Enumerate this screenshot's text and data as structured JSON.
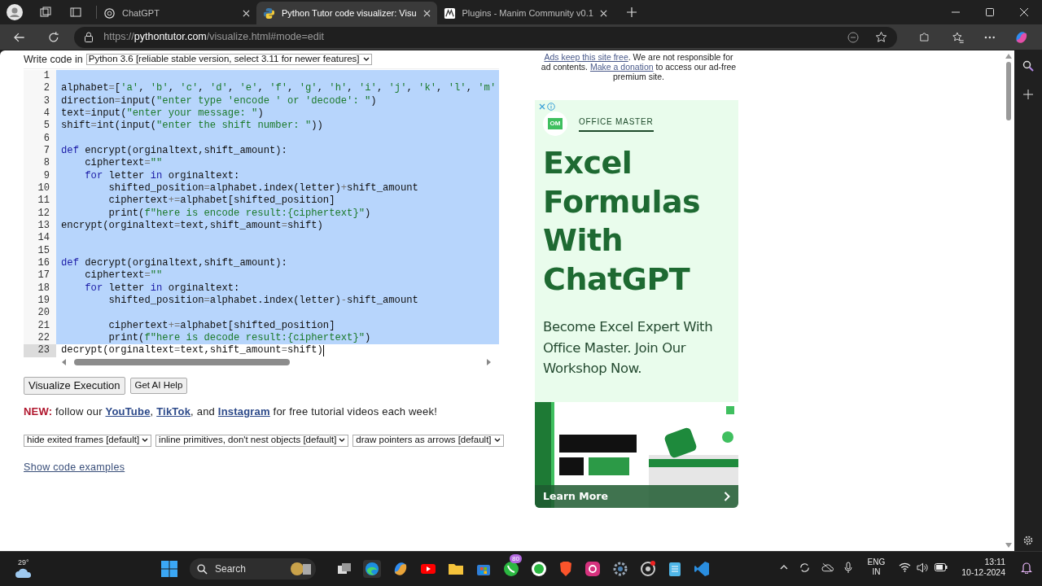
{
  "browser": {
    "tabs": [
      {
        "kind": "chat",
        "title": "ChatGPT",
        "selected": false
      },
      {
        "kind": "python",
        "title": "Python Tutor code visualizer: Visu",
        "selected": true
      },
      {
        "kind": "manim",
        "title": "Plugins - Manim Community v0.1",
        "selected": false
      }
    ],
    "address": {
      "scheme": "https://",
      "host": "pythontutor.com",
      "path": "/visualize.html#mode=edit"
    }
  },
  "editor": {
    "language_label": "Write code in",
    "language": "Python 3.6 [reliable stable version, select 3.11 for newer features]",
    "lines": [
      {
        "number": "1",
        "selected": true,
        "active": false
      },
      {
        "number": "2",
        "selected": true,
        "active": false,
        "tokens": [
          {
            "kind": "plain",
            "text": "alphabet"
          },
          {
            "kind": "operator",
            "text": "="
          },
          {
            "kind": "plain",
            "text": "["
          },
          {
            "kind": "string",
            "text": "'a'"
          },
          {
            "kind": "plain",
            "text": ", "
          },
          {
            "kind": "string",
            "text": "'b'"
          },
          {
            "kind": "plain",
            "text": ", "
          },
          {
            "kind": "string",
            "text": "'c'"
          },
          {
            "kind": "plain",
            "text": ", "
          },
          {
            "kind": "string",
            "text": "'d'"
          },
          {
            "kind": "plain",
            "text": ", "
          },
          {
            "kind": "string",
            "text": "'e'"
          },
          {
            "kind": "plain",
            "text": ", "
          },
          {
            "kind": "string",
            "text": "'f'"
          },
          {
            "kind": "plain",
            "text": ", "
          },
          {
            "kind": "string",
            "text": "'g'"
          },
          {
            "kind": "plain",
            "text": ", "
          },
          {
            "kind": "string",
            "text": "'h'"
          },
          {
            "kind": "plain",
            "text": ", "
          },
          {
            "kind": "string",
            "text": "'i'"
          },
          {
            "kind": "plain",
            "text": ", "
          },
          {
            "kind": "string",
            "text": "'j'"
          },
          {
            "kind": "plain",
            "text": ", "
          },
          {
            "kind": "string",
            "text": "'k'"
          },
          {
            "kind": "plain",
            "text": ", "
          },
          {
            "kind": "string",
            "text": "'l'"
          },
          {
            "kind": "plain",
            "text": ", "
          },
          {
            "kind": "string",
            "text": "'m'"
          }
        ]
      },
      {
        "number": "3",
        "selected": true,
        "active": false,
        "tokens": [
          {
            "kind": "plain",
            "text": "direction"
          },
          {
            "kind": "operator",
            "text": "="
          },
          {
            "kind": "plain",
            "text": "input("
          },
          {
            "kind": "string",
            "text": "\"enter type 'encode ' or 'decode': \""
          },
          {
            "kind": "plain",
            "text": ")"
          }
        ]
      },
      {
        "number": "4",
        "selected": true,
        "active": false,
        "tokens": [
          {
            "kind": "plain",
            "text": "text"
          },
          {
            "kind": "operator",
            "text": "="
          },
          {
            "kind": "plain",
            "text": "input("
          },
          {
            "kind": "string",
            "text": "\"enter your message: \""
          },
          {
            "kind": "plain",
            "text": ")"
          }
        ]
      },
      {
        "number": "5",
        "selected": true,
        "active": false,
        "tokens": [
          {
            "kind": "plain",
            "text": "shift"
          },
          {
            "kind": "operator",
            "text": "="
          },
          {
            "kind": "plain",
            "text": "int(input("
          },
          {
            "kind": "string",
            "text": "\"enter the shift number: \""
          },
          {
            "kind": "plain",
            "text": "))"
          }
        ]
      },
      {
        "number": "6",
        "selected": true,
        "active": false
      },
      {
        "number": "7",
        "selected": true,
        "active": false,
        "tokens": [
          {
            "kind": "keyword",
            "text": "def"
          },
          {
            "kind": "plain",
            "text": " encrypt(orginaltext,shift_amount):"
          }
        ]
      },
      {
        "number": "8",
        "selected": true,
        "active": false,
        "tokens": [
          {
            "kind": "plain",
            "text": "    ciphertext"
          },
          {
            "kind": "operator",
            "text": "="
          },
          {
            "kind": "string",
            "text": "\"\""
          }
        ]
      },
      {
        "number": "9",
        "selected": true,
        "active": false,
        "tokens": [
          {
            "kind": "keyword",
            "text": "    for"
          },
          {
            "kind": "plain",
            "text": " letter "
          },
          {
            "kind": "keyword",
            "text": "in"
          },
          {
            "kind": "plain",
            "text": " orginaltext:"
          }
        ]
      },
      {
        "number": "10",
        "selected": true,
        "active": false,
        "tokens": [
          {
            "kind": "plain",
            "text": "        shifted_position"
          },
          {
            "kind": "operator",
            "text": "="
          },
          {
            "kind": "plain",
            "text": "alphabet.index(letter)"
          },
          {
            "kind": "operator",
            "text": "+"
          },
          {
            "kind": "plain",
            "text": "shift_amount"
          }
        ]
      },
      {
        "number": "11",
        "selected": true,
        "active": false,
        "tokens": [
          {
            "kind": "plain",
            "text": "        ciphertext"
          },
          {
            "kind": "operator",
            "text": "+="
          },
          {
            "kind": "plain",
            "text": "alphabet[shifted_position]"
          }
        ]
      },
      {
        "number": "12",
        "selected": true,
        "active": false,
        "tokens": [
          {
            "kind": "plain",
            "text": "        print("
          },
          {
            "kind": "string",
            "text": "f\"here is encode result:{ciphertext}\""
          },
          {
            "kind": "plain",
            "text": ")"
          }
        ]
      },
      {
        "number": "13",
        "selected": true,
        "active": false,
        "tokens": [
          {
            "kind": "plain",
            "text": "encrypt(orginaltext"
          },
          {
            "kind": "operator",
            "text": "="
          },
          {
            "kind": "plain",
            "text": "text,shift_amount"
          },
          {
            "kind": "operator",
            "text": "="
          },
          {
            "kind": "plain",
            "text": "shift)"
          }
        ]
      },
      {
        "number": "14",
        "selected": true,
        "active": false
      },
      {
        "number": "15",
        "selected": true,
        "active": false
      },
      {
        "number": "16",
        "selected": true,
        "active": false,
        "tokens": [
          {
            "kind": "keyword",
            "text": "def"
          },
          {
            "kind": "plain",
            "text": " decrypt(orginaltext,shift_amount):"
          }
        ]
      },
      {
        "number": "17",
        "selected": true,
        "active": false,
        "tokens": [
          {
            "kind": "plain",
            "text": "    ciphertext"
          },
          {
            "kind": "operator",
            "text": "="
          },
          {
            "kind": "string",
            "text": "\"\""
          }
        ]
      },
      {
        "number": "18",
        "selected": true,
        "active": false,
        "tokens": [
          {
            "kind": "keyword",
            "text": "    for"
          },
          {
            "kind": "plain",
            "text": " letter "
          },
          {
            "kind": "keyword",
            "text": "in"
          },
          {
            "kind": "plain",
            "text": " orginaltext:"
          }
        ]
      },
      {
        "number": "19",
        "selected": true,
        "active": false,
        "tokens": [
          {
            "kind": "plain",
            "text": "        shifted_position"
          },
          {
            "kind": "operator",
            "text": "="
          },
          {
            "kind": "plain",
            "text": "alphabet.index(letter)"
          },
          {
            "kind": "operator",
            "text": "-"
          },
          {
            "kind": "plain",
            "text": "shift_amount"
          }
        ]
      },
      {
        "number": "20",
        "selected": true,
        "active": false
      },
      {
        "number": "21",
        "selected": true,
        "active": false,
        "tokens": [
          {
            "kind": "plain",
            "text": "        ciphertext"
          },
          {
            "kind": "operator",
            "text": "+="
          },
          {
            "kind": "plain",
            "text": "alphabet[shifted_position]"
          }
        ]
      },
      {
        "number": "22",
        "selected": true,
        "active": false,
        "tokens": [
          {
            "kind": "plain",
            "text": "        print("
          },
          {
            "kind": "string",
            "text": "f\"here is decode result:{ciphertext}\""
          },
          {
            "kind": "plain",
            "text": ")"
          }
        ]
      },
      {
        "number": "23",
        "selected": false,
        "active": true,
        "tokens": [
          {
            "kind": "plain",
            "text": "decrypt(orginaltext"
          },
          {
            "kind": "operator",
            "text": "="
          },
          {
            "kind": "plain",
            "text": "text,shift_amount"
          },
          {
            "kind": "operator",
            "text": "="
          },
          {
            "kind": "plain",
            "text": "shift)"
          }
        ]
      }
    ]
  },
  "actions": [
    "Visualize Execution",
    "Get AI Help"
  ],
  "notice": [
    {
      "kind": "label",
      "text": "NEW:"
    },
    {
      "kind": "text",
      "text": " follow our "
    },
    {
      "kind": "link",
      "text": "YouTube"
    },
    {
      "kind": "text",
      "text": ", "
    },
    {
      "kind": "link",
      "text": "TikTok"
    },
    {
      "kind": "text",
      "text": ", and "
    },
    {
      "kind": "link",
      "text": "Instagram"
    },
    {
      "kind": "text",
      "text": " for free tutorial videos each week!"
    }
  ],
  "options": [
    "hide exited frames [default]",
    "inline primitives, don't nest objects [default]",
    "draw pointers as arrows [default]"
  ],
  "examples_link": "Show code examples",
  "ad_notice": [
    {
      "kind": "link",
      "text": "Ads keep this site free"
    },
    {
      "kind": "text",
      "text": ". We are not responsible for ad contents. "
    },
    {
      "kind": "link",
      "text": "Make a donation"
    },
    {
      "kind": "text",
      "text": " to access our ad-free premium site."
    }
  ],
  "ad": {
    "logo": "OM",
    "brand": "OFFICE MASTER",
    "headline": "Excel Formulas With ChatGPT",
    "body": "Become Excel Expert With Office Master. Join Our Workshop Now.",
    "cta": "Learn More"
  },
  "taskbar": {
    "weather": "29°",
    "search": "Search",
    "badge": "80",
    "language": [
      "ENG",
      "IN"
    ],
    "time": "13:11",
    "date": "10-12-2024"
  }
}
